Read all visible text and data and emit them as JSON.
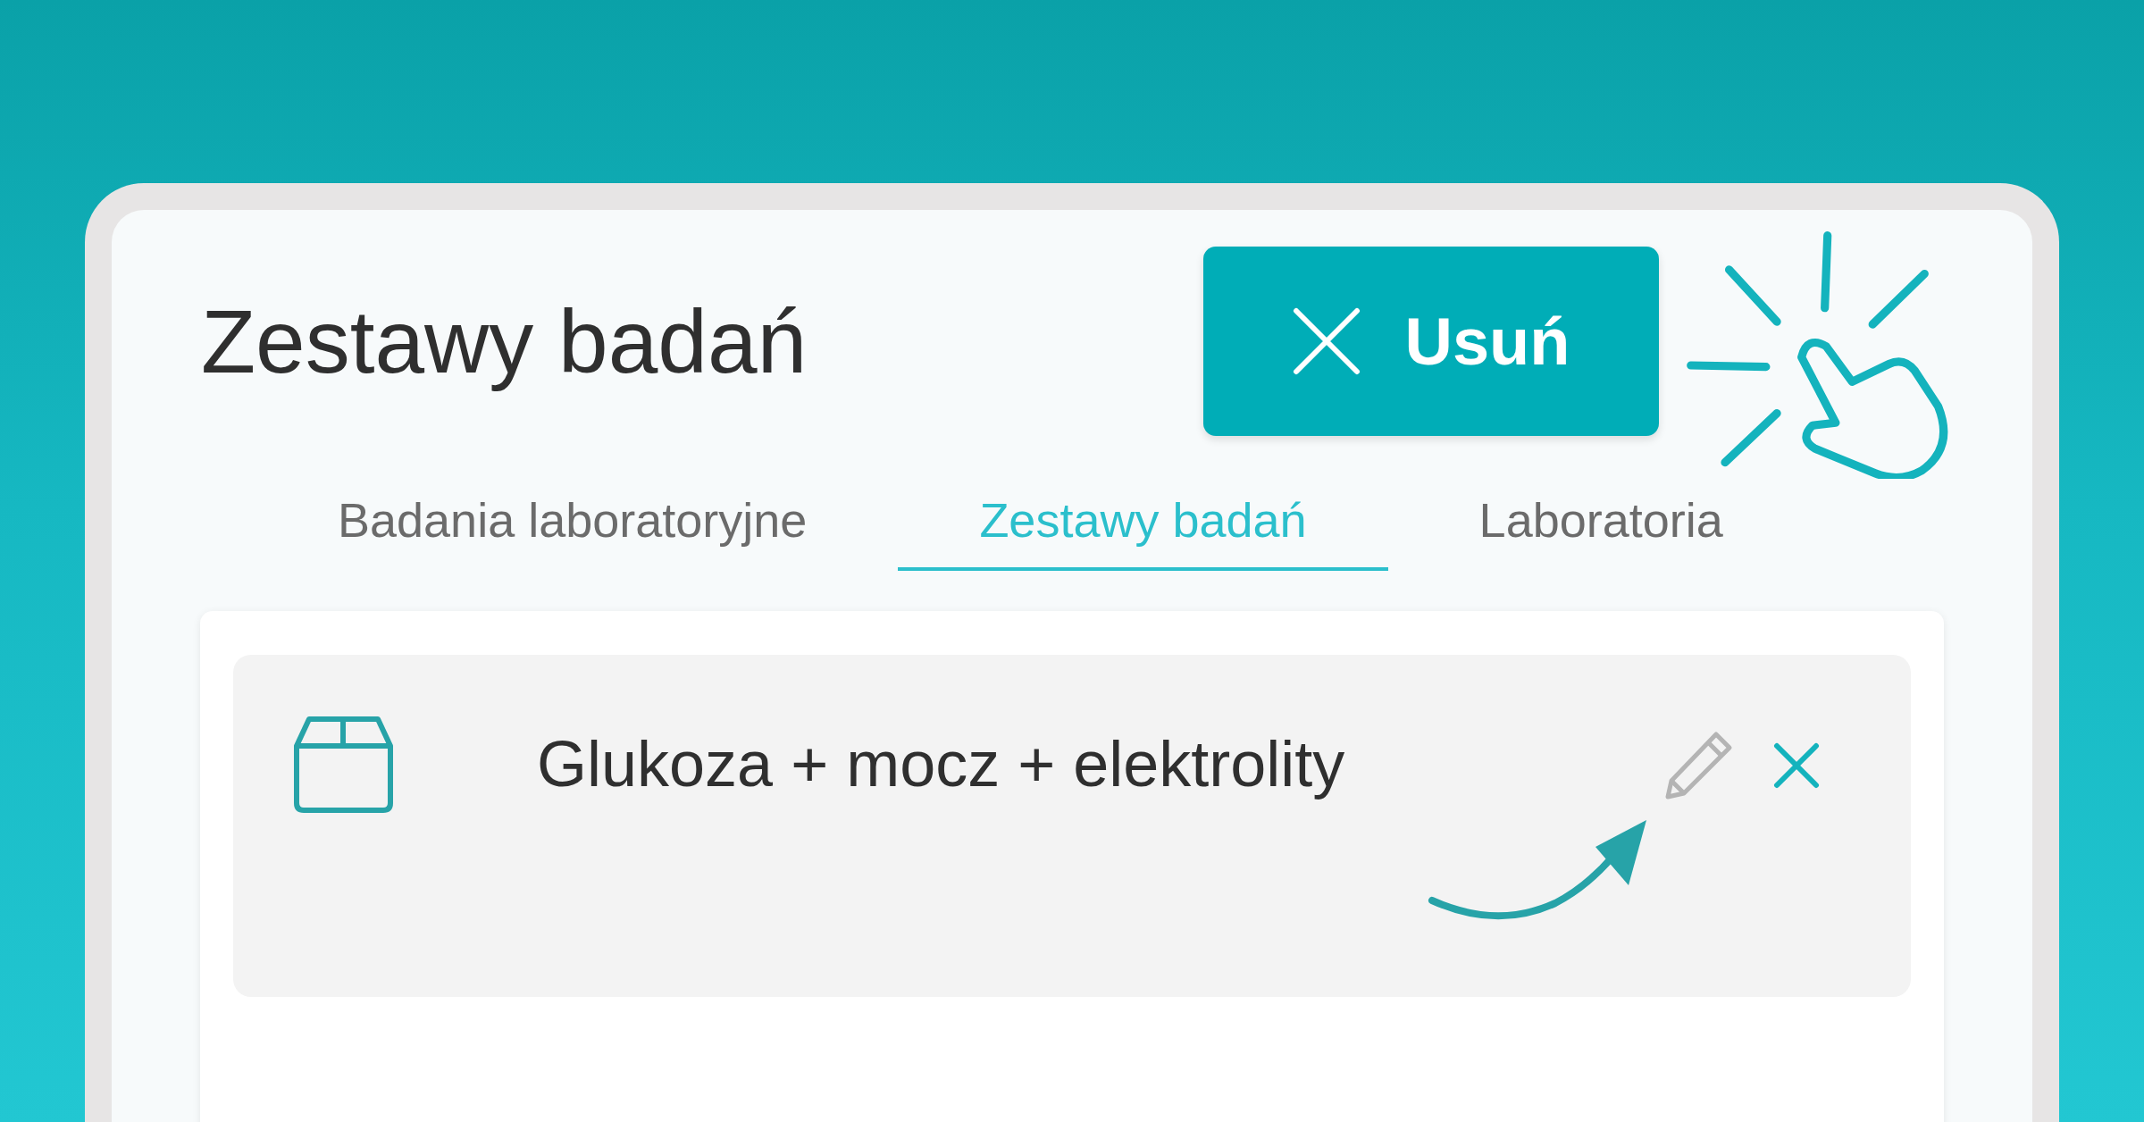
{
  "title": "Zestawy badań",
  "delete_button": {
    "label": "Usuń"
  },
  "tabs": [
    {
      "label": "Badania laboratoryjne",
      "selected": false
    },
    {
      "label": "Zestawy badań",
      "selected": true
    },
    {
      "label": "Laboratoria",
      "selected": false
    }
  ],
  "items": [
    {
      "name": "Glukoza + mocz + elektrolity"
    }
  ]
}
